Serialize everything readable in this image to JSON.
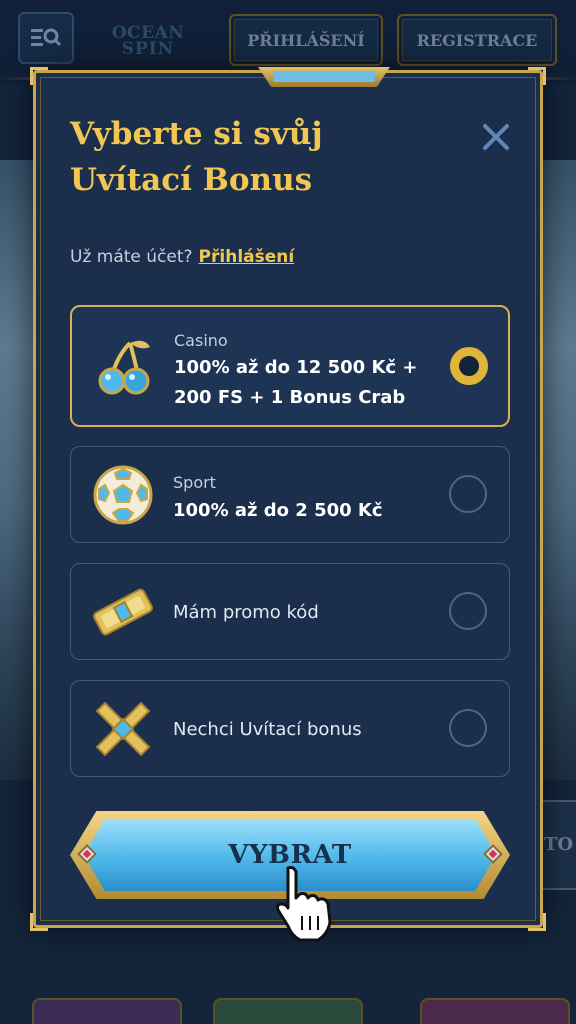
{
  "header": {
    "logo_line1": "OCEAN",
    "logo_line2": "SPIN",
    "login_label": "PŘIHLÁŠENÍ",
    "register_label": "REGISTRACE"
  },
  "background": {
    "side_button_text": "TO"
  },
  "modal": {
    "title": "Vyberte si svůj Uvítací Bonus",
    "subtitle_prefix": "Už máte účet?",
    "login_link": "Přihlášení",
    "options": [
      {
        "icon": "cherries-icon",
        "small": "Casino",
        "main": "100% až do 12 500 Kč + 200 FS + 1 Bonus Crab",
        "selected": true
      },
      {
        "icon": "soccer-ball-icon",
        "small": "Sport",
        "main": "100% až do 2 500 Kč",
        "selected": false
      },
      {
        "icon": "ticket-icon",
        "label": "Mám promo kód",
        "selected": false
      },
      {
        "icon": "cross-icon",
        "label": "Nechci Uvítací bonus",
        "selected": false
      }
    ],
    "select_button": "VYBRAT"
  },
  "colors": {
    "gold": "#f1c653",
    "panel": "#1b2f4d",
    "accent_blue": "#4eb8ea"
  }
}
